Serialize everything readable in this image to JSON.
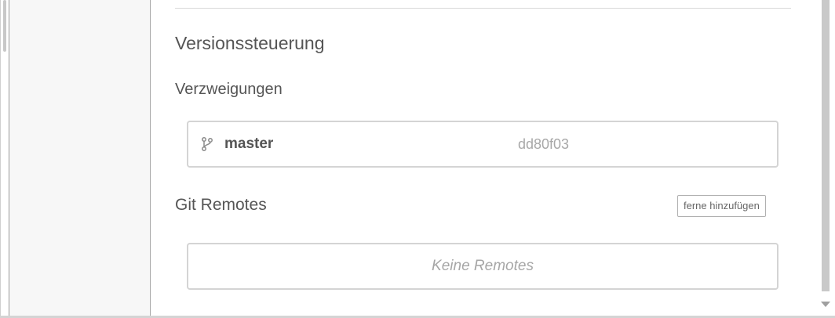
{
  "version_control": {
    "title": "Versionssteuerung"
  },
  "branches": {
    "title": "Verzweigungen",
    "items": [
      {
        "icon": "git-branch-icon",
        "name": "master",
        "hash": "dd80f03"
      }
    ]
  },
  "remotes": {
    "title": "Git Remotes",
    "add_button_label": "ferne hinzufügen",
    "empty_text": "Keine Remotes"
  },
  "colors": {
    "text": "#555555",
    "muted": "#a8a8a8",
    "border": "#d4d4d4",
    "sidebar_bg": "#f7f7f7"
  }
}
